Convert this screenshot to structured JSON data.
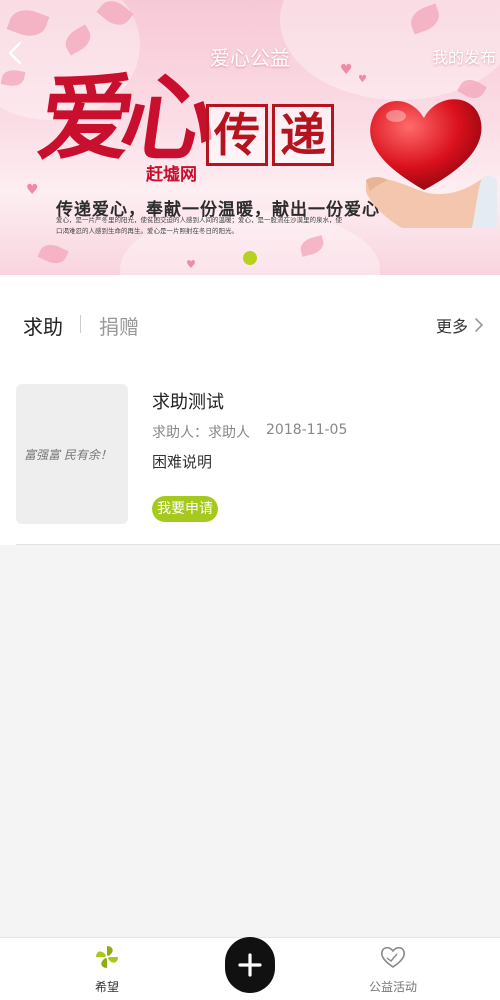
{
  "header": {
    "title": "爱心公益",
    "right_action": "我的发布"
  },
  "banner": {
    "calligraphy": "爱心",
    "seal_chars": [
      "传",
      "递"
    ],
    "brand": "赶墟网",
    "slogan": "传递爱心，奉献一份温暖，献出一份爱心",
    "small_text": "爱心，是一片严冬里的阳光，使贫困交迫的人感到人间的温暖；爱心，是一股流在沙漠里的泉水，使口渴难忍的人感到生命的再生。爱心是一片照射在冬日的阳光。",
    "indicator_color": "#b6d21e"
  },
  "tabs": {
    "active": "求助",
    "inactive": "捐赠",
    "more": "更多"
  },
  "items": [
    {
      "title": "求助测试",
      "requester": "求助人：求助人",
      "date": "2018-11-05",
      "description": "困难说明",
      "button": "我要申请",
      "thumb_text": "富强富  民有余！"
    }
  ],
  "bottom_nav": {
    "items": [
      {
        "label": "希望",
        "icon": "pinwheel-icon"
      },
      {
        "label": "公益活动",
        "icon": "heart-hands-icon"
      }
    ],
    "fab_icon": "plus-icon"
  },
  "colors": {
    "accent": "#a6c91d",
    "banner_red": "#c8102e"
  }
}
